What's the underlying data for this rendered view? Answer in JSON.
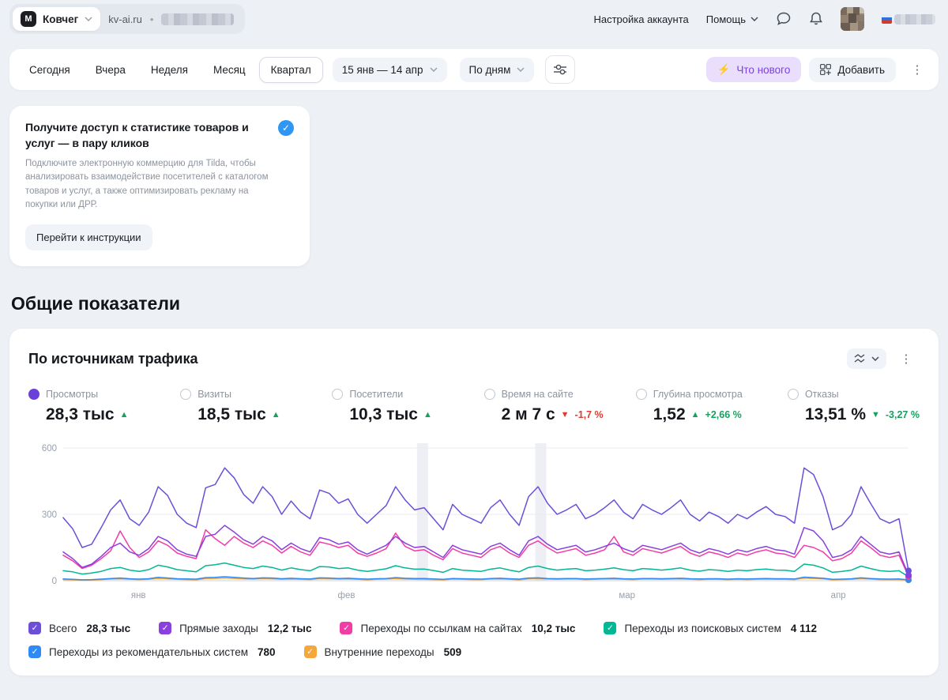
{
  "header": {
    "counter_name": "Ковчег",
    "site": "kv-ai.ru",
    "separator": "•",
    "account_settings": "Настройка аккаунта",
    "help": "Помощь"
  },
  "icons": {
    "kebab": "⋮",
    "lightning": "⚡",
    "check": "✓",
    "logo_letter": "М"
  },
  "toolbar": {
    "periods": [
      "Сегодня",
      "Вчера",
      "Неделя",
      "Месяц",
      "Квартал"
    ],
    "selected_period": "Квартал",
    "date_range": "15 янв — 14 апр",
    "grouping": "По дням",
    "whats_new": "Что нового",
    "add": "Добавить"
  },
  "promo": {
    "title": "Получите доступ к статистике товаров и услуг — в пару кликов",
    "body": "Подключите электронную коммерцию для Tilda, чтобы анализировать взаимодействие посетителей с каталогом товаров и услуг, а также оптимизировать рекламу на покупки или ДРР.",
    "button": "Перейти к инструкции"
  },
  "section_title": "Общие показатели",
  "card": {
    "title": "По источникам трафика"
  },
  "metrics": [
    {
      "label": "Просмотры",
      "value": "28,3 тыс",
      "arrow": "▲",
      "delta": "",
      "selected": true
    },
    {
      "label": "Визиты",
      "value": "18,5 тыс",
      "arrow": "▲",
      "delta": ""
    },
    {
      "label": "Посетители",
      "value": "10,3 тыс",
      "arrow": "▲",
      "delta": ""
    },
    {
      "label": "Время на сайте",
      "value": "2 м 7 с",
      "arrow": "▼",
      "delta": "-1,7 %"
    },
    {
      "label": "Глубина просмотра",
      "value": "1,52",
      "arrow": "▲",
      "delta": "+2,66 %"
    },
    {
      "label": "Отказы",
      "value": "13,51 %",
      "arrow": "▼",
      "delta": "-3,27 %"
    }
  ],
  "legend": [
    {
      "label": "Всего",
      "value": "28,3 тыс",
      "color": "#6d4ed9"
    },
    {
      "label": "Прямые заходы",
      "value": "12,2 тыс",
      "color": "#8a3fe0"
    },
    {
      "label": "Переходы по ссылкам на сайтах",
      "value": "10,2 тыс",
      "color": "#f23ca6"
    },
    {
      "label": "Переходы из поисковых систем",
      "value": "4 112",
      "color": "#00b894"
    },
    {
      "label": "Переходы из рекомендательных систем",
      "value": "780",
      "color": "#2f8af5"
    },
    {
      "label": "Внутренние переходы",
      "value": "509",
      "color": "#f5a73b"
    }
  ],
  "chart_data": {
    "type": "line",
    "title": "По источникам трафика",
    "x_start": "15 янв",
    "x_end": "14 апр",
    "ylim": [
      0,
      600
    ],
    "yticks": [
      0,
      300,
      600
    ],
    "xticks": [
      {
        "label": "янв",
        "pos": 0.089
      },
      {
        "label": "фев",
        "pos": 0.335
      },
      {
        "label": "мар",
        "pos": 0.667
      },
      {
        "label": "апр",
        "pos": 0.917
      }
    ],
    "highlight_bands": [
      0.425,
      0.565
    ],
    "series": [
      {
        "name": "Всего",
        "color": "#6d4ed9",
        "values": [
          285,
          235,
          150,
          165,
          240,
          320,
          365,
          280,
          250,
          310,
          425,
          385,
          300,
          260,
          240,
          420,
          435,
          510,
          465,
          390,
          350,
          425,
          380,
          300,
          360,
          310,
          280,
          410,
          395,
          350,
          370,
          300,
          260,
          300,
          340,
          425,
          365,
          320,
          330,
          280,
          230,
          345,
          300,
          280,
          260,
          330,
          365,
          300,
          250,
          380,
          425,
          350,
          300,
          320,
          345,
          280,
          300,
          330,
          365,
          310,
          280,
          345,
          320,
          300,
          330,
          365,
          300,
          270,
          310,
          290,
          260,
          300,
          280,
          310,
          335,
          300,
          290,
          260,
          510,
          480,
          380,
          230,
          250,
          300,
          425,
          350,
          280,
          260,
          280,
          45
        ]
      },
      {
        "name": "Прямые заходы",
        "color": "#8a3fe0",
        "values": [
          130,
          100,
          60,
          75,
          110,
          150,
          170,
          130,
          115,
          145,
          200,
          180,
          140,
          120,
          110,
          200,
          210,
          250,
          220,
          185,
          165,
          200,
          180,
          140,
          170,
          145,
          130,
          195,
          185,
          165,
          175,
          140,
          120,
          140,
          160,
          200,
          170,
          150,
          155,
          130,
          105,
          160,
          140,
          130,
          120,
          155,
          170,
          140,
          115,
          180,
          200,
          165,
          140,
          150,
          160,
          130,
          140,
          155,
          170,
          145,
          130,
          160,
          150,
          140,
          155,
          170,
          140,
          125,
          145,
          135,
          120,
          140,
          130,
          145,
          155,
          140,
          135,
          120,
          240,
          225,
          180,
          105,
          115,
          140,
          200,
          165,
          130,
          120,
          130,
          25
        ]
      },
      {
        "name": "Переходы по ссылкам на сайтах",
        "color": "#f23ca6",
        "values": [
          115,
          90,
          55,
          70,
          100,
          135,
          225,
          150,
          105,
          130,
          180,
          160,
          125,
          110,
          100,
          230,
          190,
          160,
          200,
          170,
          150,
          180,
          160,
          125,
          155,
          130,
          115,
          175,
          165,
          150,
          160,
          125,
          110,
          125,
          145,
          215,
          155,
          135,
          140,
          115,
          95,
          145,
          125,
          115,
          105,
          140,
          155,
          125,
          105,
          160,
          180,
          150,
          125,
          135,
          145,
          115,
          125,
          140,
          200,
          130,
          115,
          145,
          135,
          125,
          140,
          155,
          125,
          110,
          130,
          120,
          105,
          125,
          115,
          130,
          140,
          125,
          120,
          105,
          160,
          150,
          130,
          90,
          100,
          125,
          180,
          150,
          115,
          105,
          115,
          20
        ]
      },
      {
        "name": "Переходы из поисковых систем",
        "color": "#00b894",
        "values": [
          45,
          40,
          30,
          35,
          42,
          55,
          60,
          48,
          42,
          50,
          70,
          62,
          50,
          45,
          40,
          68,
          72,
          80,
          70,
          60,
          55,
          66,
          60,
          48,
          58,
          50,
          45,
          64,
          62,
          55,
          58,
          48,
          42,
          48,
          54,
          68,
          58,
          52,
          53,
          46,
          38,
          55,
          48,
          45,
          42,
          52,
          58,
          48,
          40,
          60,
          66,
          55,
          48,
          52,
          55,
          45,
          48,
          52,
          58,
          50,
          45,
          55,
          52,
          48,
          52,
          58,
          48,
          43,
          50,
          47,
          42,
          48,
          45,
          50,
          53,
          48,
          47,
          42,
          75,
          70,
          58,
          38,
          42,
          48,
          66,
          55,
          45,
          42,
          45,
          18
        ]
      },
      {
        "name": "Переходы из рекомендательных систем",
        "color": "#2f8af5",
        "values": [
          8,
          6,
          4,
          5,
          7,
          10,
          12,
          9,
          7,
          9,
          15,
          12,
          9,
          8,
          7,
          14,
          15,
          18,
          15,
          12,
          10,
          13,
          12,
          9,
          11,
          9,
          8,
          13,
          12,
          10,
          11,
          9,
          7,
          9,
          10,
          14,
          11,
          10,
          10,
          8,
          6,
          10,
          9,
          8,
          7,
          10,
          11,
          9,
          7,
          12,
          13,
          10,
          9,
          10,
          10,
          8,
          9,
          10,
          11,
          9,
          8,
          10,
          10,
          9,
          10,
          11,
          9,
          8,
          9,
          9,
          7,
          9,
          8,
          9,
          10,
          9,
          9,
          8,
          16,
          14,
          11,
          6,
          7,
          9,
          13,
          10,
          8,
          7,
          8,
          4
        ]
      },
      {
        "name": "Внутренние переходы",
        "color": "#f5a73b",
        "values": [
          5,
          4,
          2,
          3,
          5,
          7,
          8,
          6,
          5,
          6,
          10,
          8,
          6,
          5,
          4,
          9,
          10,
          12,
          10,
          8,
          7,
          9,
          8,
          6,
          7,
          6,
          5,
          9,
          8,
          7,
          7,
          6,
          4,
          6,
          7,
          9,
          7,
          6,
          6,
          5,
          4,
          7,
          6,
          5,
          5,
          7,
          7,
          6,
          4,
          8,
          9,
          7,
          6,
          7,
          7,
          5,
          6,
          7,
          7,
          6,
          5,
          7,
          7,
          6,
          7,
          7,
          6,
          5,
          6,
          6,
          5,
          6,
          5,
          6,
          7,
          6,
          6,
          5,
          11,
          10,
          8,
          4,
          5,
          6,
          9,
          7,
          5,
          5,
          5,
          3
        ]
      }
    ]
  }
}
